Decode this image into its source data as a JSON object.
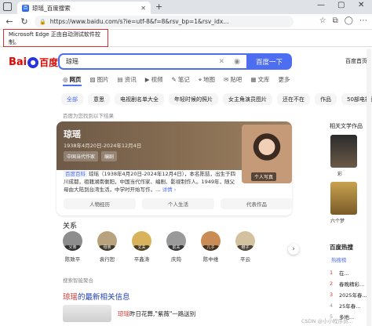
{
  "browser": {
    "tab_title": "琼瑶_百度搜索",
    "favicon_text": "百",
    "address": "https://www.baidu.com/s?ie=utf-8&f=8&rsv_bp=1&rsv_idx...",
    "automation_notice": "Microsoft Edge 正由自动测试软件控制。"
  },
  "baidu": {
    "logo_bai": "Bai",
    "logo_du": "百度",
    "query": "琼瑶",
    "search_button": "百度一下",
    "homepage_link": "百度首页",
    "verticals": [
      "网页",
      "图片",
      "资讯",
      "视频",
      "笔记",
      "地图",
      "贴吧",
      "文库",
      "更多"
    ],
    "filters": [
      "全部",
      "意思",
      "电视剧名单大全",
      "年轻时候的照片",
      "女主角演员图片",
      "还在不在",
      "作品",
      "50部电视剧"
    ],
    "result_hint": "百度为您找到以下结果"
  },
  "card": {
    "name": "琼瑶",
    "dates": "1938年4月20日-2024年12月4日",
    "tags": [
      "中国当代作家",
      "编剧"
    ],
    "portrait_label": "个人写真",
    "source_badge": "百度百科",
    "summary": "琼瑶（1938年4月20日-2024年12月4日），本名陈喆，出生于四川成都，祖籍湖南衡阳，中国当代作家、编剧、影视制作人。1949年，随父母由大陆到台湾生活，中学时开始写作，…",
    "more_link": "详情 ›",
    "buttons": [
      "人物经历",
      "个人生活",
      "代表作品"
    ]
  },
  "relations": {
    "title": "关系",
    "people": [
      {
        "badge": "父亲",
        "name": "陈致平"
      },
      {
        "badge": "母亲",
        "name": "袁行恕"
      },
      {
        "badge": "丈夫",
        "name": "平鑫涛"
      },
      {
        "badge": "前夫",
        "name": "庆筠"
      },
      {
        "badge": "儿子",
        "name": "陈中维"
      },
      {
        "badge": "继子",
        "name": "平云"
      }
    ],
    "next_arrow": "›"
  },
  "smart_hint": "搜索智能聚合",
  "news": {
    "title_highlight": "琼瑶",
    "title_rest": "的最新相关信息",
    "item_highlight": "琼瑶",
    "item_rest": "昨日花葬,\"紫薇\"一路送别"
  },
  "right": {
    "related_title": "相关文学作品",
    "book1_cap": "彩",
    "book2_cap": "六个梦",
    "hot_title": "百度热搜",
    "hot_tab": "热搜榜",
    "hot_items": [
      {
        "rank": "1",
        "text": "在..."
      },
      {
        "rank": "2",
        "text": "春晚精彩..."
      },
      {
        "rank": "3",
        "text": "2025年春..."
      },
      {
        "rank": "4",
        "text": "25年春..."
      },
      {
        "rank": "5",
        "text": "多地..."
      }
    ]
  },
  "watermark": "CSDN @小小程序员..."
}
